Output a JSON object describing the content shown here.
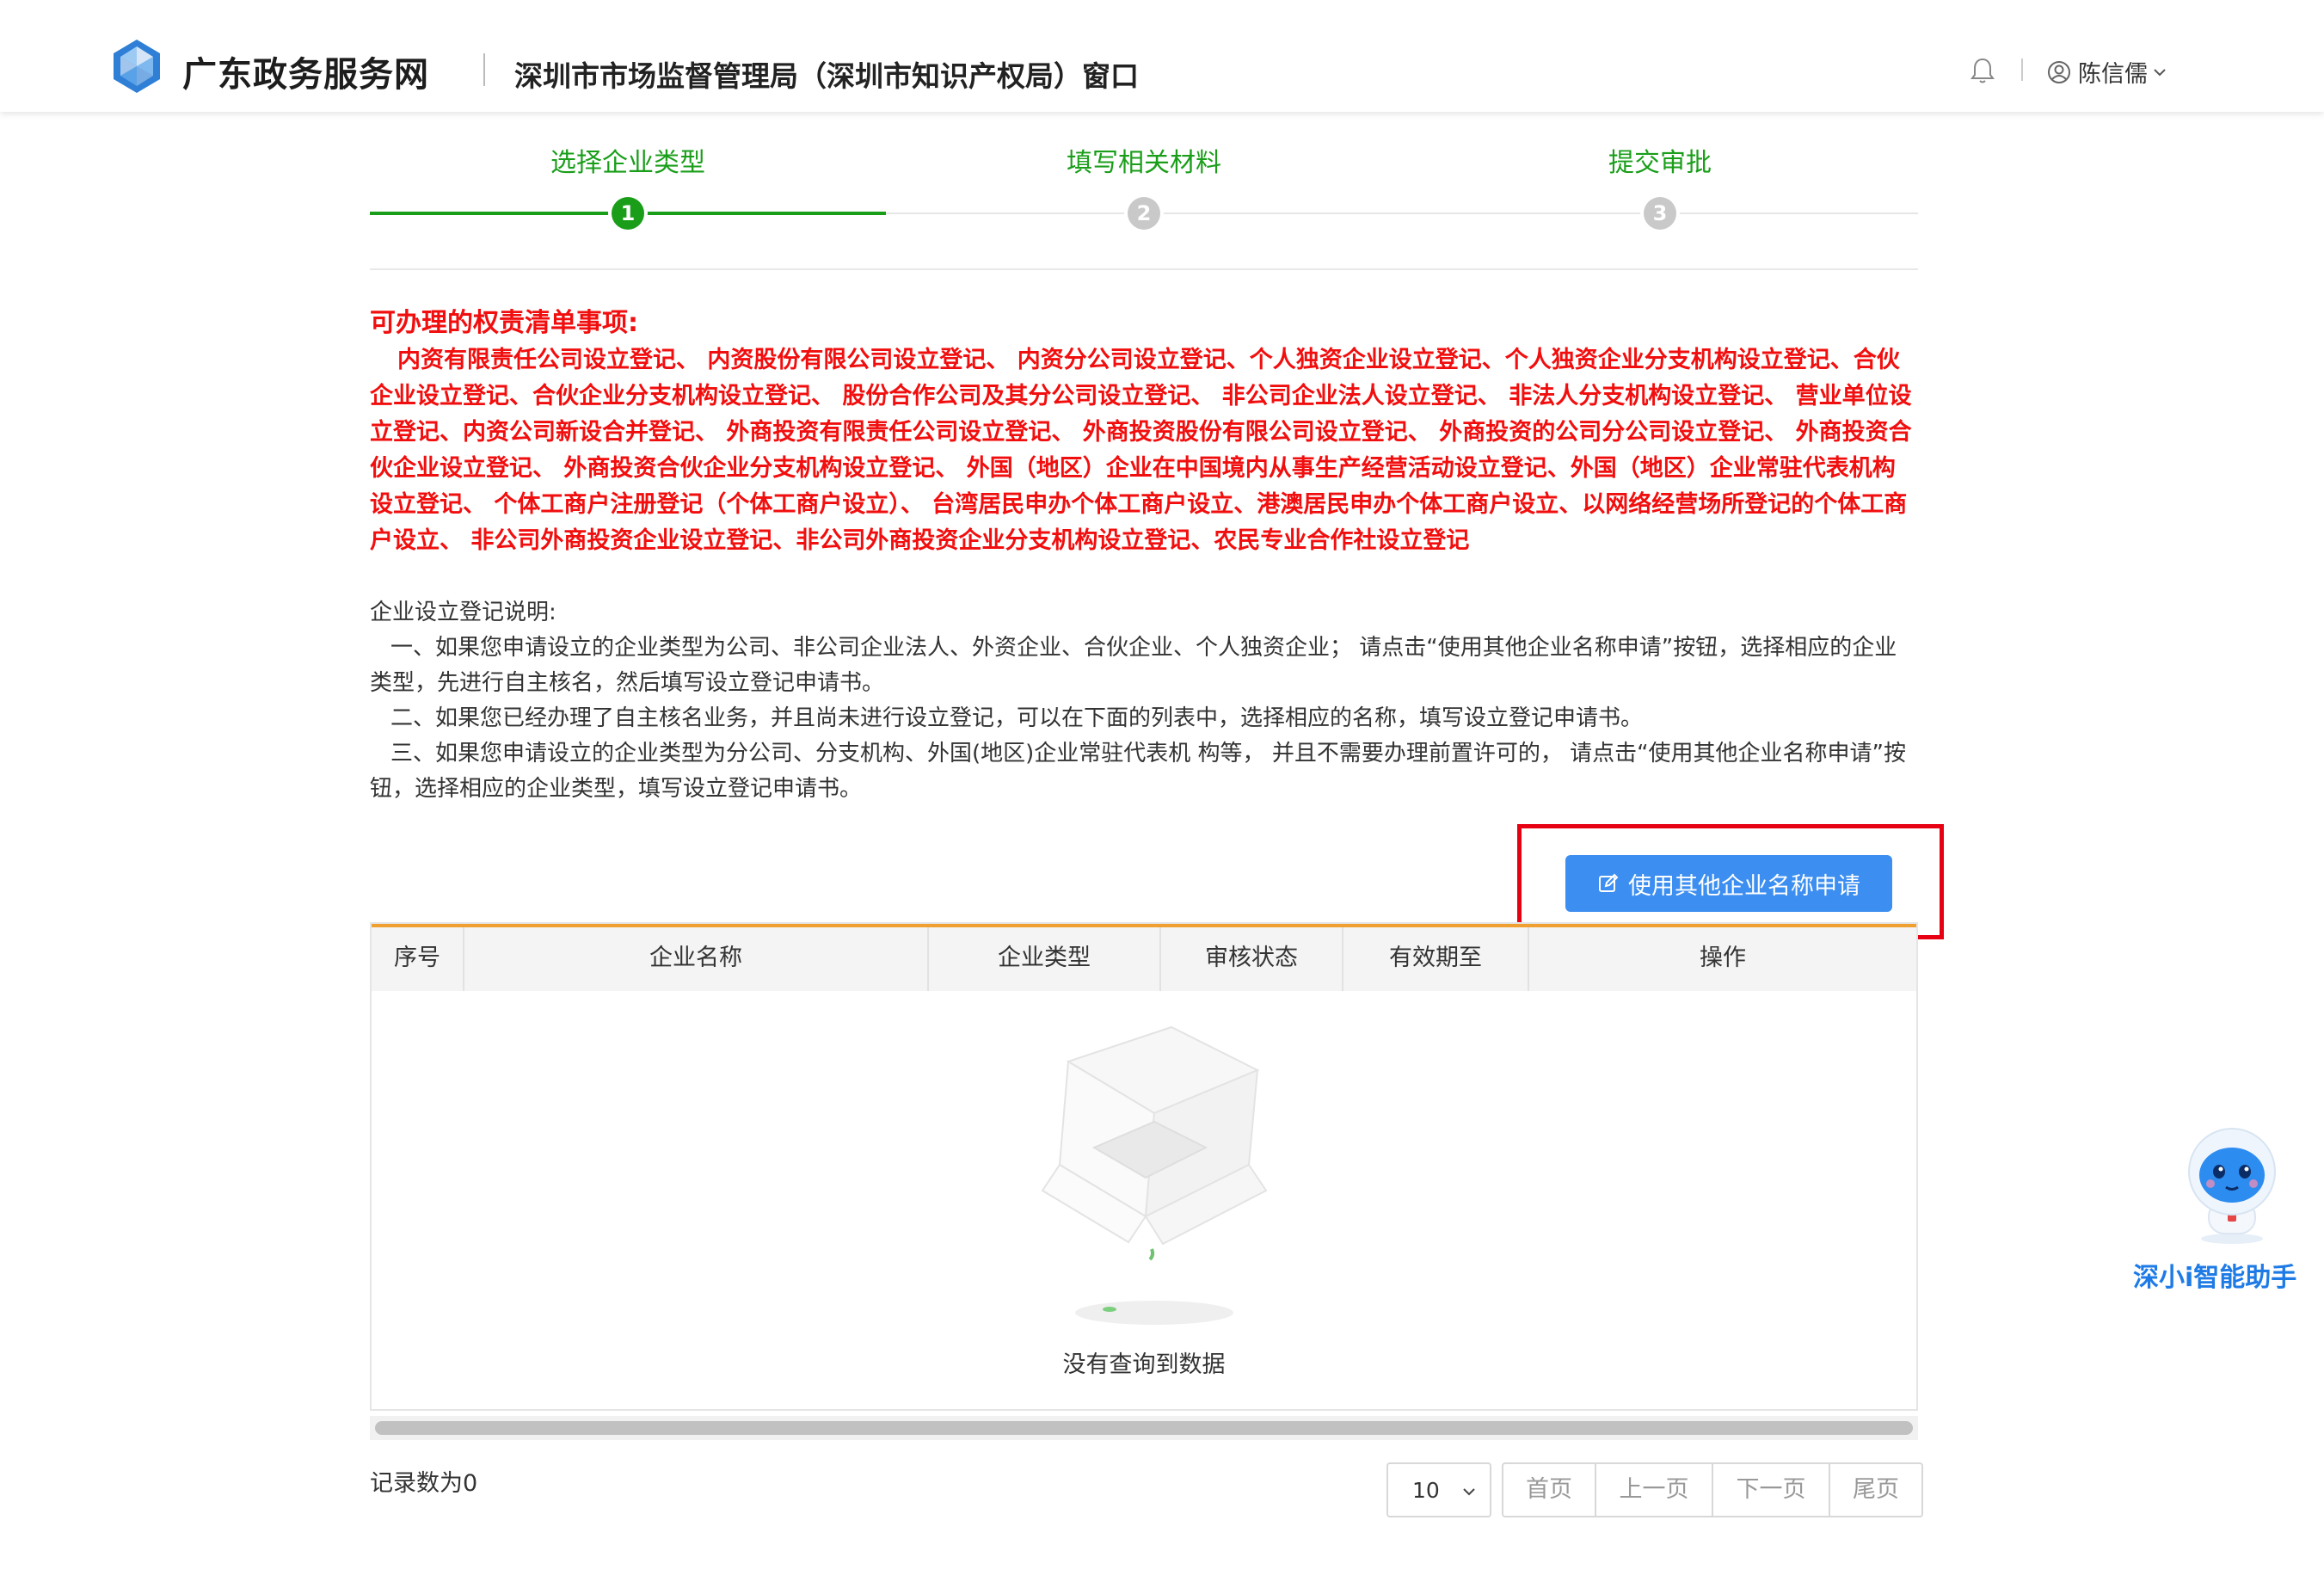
{
  "header": {
    "site_name": "广东政务服务网",
    "window_title": "深圳市市场监督管理局（深圳市知识产权局）窗口",
    "user_name": "陈信儒"
  },
  "steps": [
    {
      "label": "选择企业类型",
      "number": "1",
      "state": "active"
    },
    {
      "label": "填写相关材料",
      "number": "2",
      "state": "pending"
    },
    {
      "label": "提交审批",
      "number": "3",
      "state": "pending"
    }
  ],
  "notice": {
    "title": "可办理的权责清单事项:",
    "body": "内资有限责任公司设立登记、 内资股份有限公司设立登记、 内资分公司设立登记、个人独资企业设立登记、个人独资企业分支机构设立登记、合伙企业设立登记、合伙企业分支机构设立登记、 股份合作公司及其分公司设立登记、 非公司企业法人设立登记、 非法人分支机构设立登记、 营业单位设立登记、内资公司新设合并登记、 外商投资有限责任公司设立登记、 外商投资股份有限公司设立登记、 外商投资的公司分公司设立登记、 外商投资合伙企业设立登记、 外商投资合伙企业分支机构设立登记、 外国（地区）企业在中国境内从事生产经营活动设立登记、外国（地区）企业常驻代表机构设立登记、 个体工商户注册登记（个体工商户设立）、 台湾居民申办个体工商户设立、港澳居民申办个体工商户设立、以网络经营场所登记的个体工商户设立、 非公司外商投资企业设立登记、非公司外商投资企业分支机构设立登记、农民专业合作社设立登记"
  },
  "description": {
    "title": "企业设立登记说明:",
    "item1": "一、如果您申请设立的企业类型为公司、非公司企业法人、外资企业、合伙企业、个人独资企业； 请点击“使用其他企业名称申请”按钮，选择相应的企业类型，先进行自主核名，然后填写设立登记申请书。",
    "item2": "二、如果您已经办理了自主核名业务，并且尚未进行设立登记，可以在下面的列表中，选择相应的名称，填写设立登记申请书。",
    "item3": "三、如果您申请设立的企业类型为分公司、分支机构、外国(地区)企业常驻代表机 构等， 并且不需要办理前置许可的， 请点击“使用其他企业名称申请”按钮，选择相应的企业类型，填写设立登记申请书。"
  },
  "action_button": "使用其他企业名称申请",
  "table": {
    "columns": [
      "序号",
      "企业名称",
      "企业类型",
      "审核状态",
      "有效期至",
      "操作"
    ],
    "rows": [],
    "empty_text": "没有查询到数据"
  },
  "footer": {
    "record_count": "记录数为0",
    "page_size": "10",
    "pager": [
      "首页",
      "上一页",
      "下一页",
      "尾页"
    ]
  },
  "assistant": {
    "label": "深小i智能助手"
  },
  "colors": {
    "accent_green": "#1a9e1a",
    "notice_red": "#f10e0e",
    "button_blue": "#3c8ef0",
    "highlight_red": "#e60012",
    "table_header_border": "#f0a030"
  }
}
